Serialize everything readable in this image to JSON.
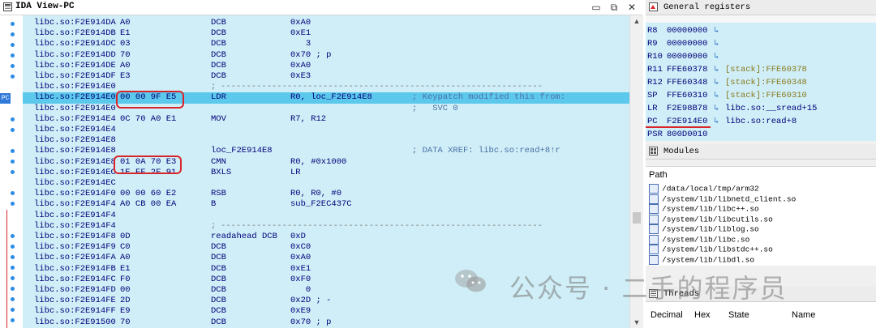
{
  "ida": {
    "title": "IDA View-PC",
    "pc_tag": "PC",
    "rows": [
      {
        "addr": "libc.so:F2E914DA",
        "bytes": "A0",
        "mnemonic": "DCB",
        "operands": "0xA0",
        "comment": ""
      },
      {
        "addr": "libc.so:F2E914DB",
        "bytes": "E1",
        "mnemonic": "DCB",
        "operands": "0xE1",
        "comment": ""
      },
      {
        "addr": "libc.so:F2E914DC",
        "bytes": "03",
        "mnemonic": "DCB",
        "operands": "   3",
        "comment": ""
      },
      {
        "addr": "libc.so:F2E914DD",
        "bytes": "70",
        "mnemonic": "DCB",
        "operands": "0x70 ; p",
        "comment": ""
      },
      {
        "addr": "libc.so:F2E914DE",
        "bytes": "A0",
        "mnemonic": "DCB",
        "operands": "0xA0",
        "comment": ""
      },
      {
        "addr": "libc.so:F2E914DF",
        "bytes": "E3",
        "mnemonic": "DCB",
        "operands": "0xE3",
        "comment": ""
      },
      {
        "addr": "libc.so:F2E914E0",
        "bytes": "",
        "mnemonic": ";",
        "operands": "",
        "comment": "---------------------------------------------------------------"
      },
      {
        "addr": "libc.so:F2E914E0",
        "bytes": "00 00 9F E5",
        "mnemonic": "LDR",
        "operands": "R0, loc_F2E914E8",
        "comment": "; Keypatch modified this from:"
      },
      {
        "addr": "libc.so:F2E914E0",
        "bytes": "",
        "mnemonic": "",
        "operands": "",
        "comment": ";   SVC 0"
      },
      {
        "addr": "libc.so:F2E914E4",
        "bytes": "0C 70 A0 E1",
        "mnemonic": "MOV",
        "operands": "R7, R12",
        "comment": ""
      },
      {
        "addr": "libc.so:F2E914E4",
        "bytes": "",
        "mnemonic": "",
        "operands": "",
        "comment": ""
      },
      {
        "addr": "libc.so:F2E914E8",
        "bytes": "",
        "mnemonic": "",
        "operands": "",
        "comment": ""
      },
      {
        "addr": "libc.so:F2E914E8",
        "bytes": "",
        "mnemonic": "loc_F2E914E8",
        "operands": "",
        "comment": "; DATA XREF: libc.so:read+8↑r"
      },
      {
        "addr": "libc.so:F2E914E8",
        "bytes": "01 0A 70 E3",
        "mnemonic": "CMN",
        "operands": "R0, #0x1000",
        "comment": ""
      },
      {
        "addr": "libc.so:F2E914EC",
        "bytes": "1E FF 2F 91",
        "mnemonic": "BXLS",
        "operands": "LR",
        "comment": ""
      },
      {
        "addr": "libc.so:F2E914EC",
        "bytes": "",
        "mnemonic": "",
        "operands": "",
        "comment": ""
      },
      {
        "addr": "libc.so:F2E914F0",
        "bytes": "00 00 60 E2",
        "mnemonic": "RSB",
        "operands": "R0, R0, #0",
        "comment": ""
      },
      {
        "addr": "libc.so:F2E914F4",
        "bytes": "A0 CB 00 EA",
        "mnemonic": "B",
        "operands": "sub_F2EC437C",
        "comment": ""
      },
      {
        "addr": "libc.so:F2E914F4",
        "bytes": "",
        "mnemonic": "",
        "operands": "",
        "comment": ""
      },
      {
        "addr": "libc.so:F2E914F4",
        "bytes": "",
        "mnemonic": ";",
        "operands": "",
        "comment": "---------------------------------------------------------------"
      },
      {
        "addr": "libc.so:F2E914F8",
        "bytes": "0D",
        "mnemonic": "readahead DCB",
        "operands": "0xD",
        "comment": ""
      },
      {
        "addr": "libc.so:F2E914F9",
        "bytes": "C0",
        "mnemonic": "DCB",
        "operands": "0xC0",
        "comment": ""
      },
      {
        "addr": "libc.so:F2E914FA",
        "bytes": "A0",
        "mnemonic": "DCB",
        "operands": "0xA0",
        "comment": ""
      },
      {
        "addr": "libc.so:F2E914FB",
        "bytes": "E1",
        "mnemonic": "DCB",
        "operands": "0xE1",
        "comment": ""
      },
      {
        "addr": "libc.so:F2E914FC",
        "bytes": "F0",
        "mnemonic": "DCB",
        "operands": "0xF0",
        "comment": ""
      },
      {
        "addr": "libc.so:F2E914FD",
        "bytes": "00",
        "mnemonic": "DCB",
        "operands": "   0",
        "comment": ""
      },
      {
        "addr": "libc.so:F2E914FE",
        "bytes": "2D",
        "mnemonic": "DCB",
        "operands": "0x2D ; -",
        "comment": ""
      },
      {
        "addr": "libc.so:F2E914FF",
        "bytes": "E9",
        "mnemonic": "DCB",
        "operands": "0xE9",
        "comment": ""
      },
      {
        "addr": "libc.so:F2E91500",
        "bytes": "70",
        "mnemonic": "DCB",
        "operands": "0x70 ; p",
        "comment": ""
      }
    ],
    "highlighted_row": 7
  },
  "registers": {
    "title": "General registers",
    "items": [
      {
        "name": "R8 ",
        "value": "00000000",
        "arrow": "↳",
        "ref": ""
      },
      {
        "name": "R9 ",
        "value": "00000000",
        "arrow": "↳",
        "ref": ""
      },
      {
        "name": "R10",
        "value": "00000000",
        "arrow": "↳",
        "ref": ""
      },
      {
        "name": "R11",
        "value": "FFE60378",
        "arrow": "↳",
        "ref": "[stack]:FFE60378"
      },
      {
        "name": "R12",
        "value": "FFE60348",
        "arrow": "↳",
        "ref": "[stack]:FFE60348"
      },
      {
        "name": "SP ",
        "value": "FFE60310",
        "arrow": "↳",
        "ref": "[stack]:FFE60310"
      },
      {
        "name": "LR ",
        "value": "F2E98B78",
        "arrow": "↳",
        "ref": "libc.so:__sread+15"
      },
      {
        "name": "PC ",
        "value": "F2E914E0",
        "arrow": "↳",
        "ref": "libc.so:read+8"
      },
      {
        "name": "PSR",
        "value": "800D0010",
        "arrow": "",
        "ref": ""
      }
    ]
  },
  "modules": {
    "title": "Modules",
    "header": "Path",
    "items": [
      "/data/local/tmp/arm32",
      "/system/lib/libnetd_client.so",
      "/system/lib/libc++.so",
      "/system/lib/libcutils.so",
      "/system/lib/liblog.so",
      "/system/lib/libc.so",
      "/system/lib/libstdc++.so",
      "/system/lib/libdl.so"
    ]
  },
  "threads": {
    "title": "Threads",
    "columns": [
      "Decimal",
      "Hex",
      "State",
      "Name"
    ]
  },
  "watermark": "公众号 · 二手的程序员"
}
